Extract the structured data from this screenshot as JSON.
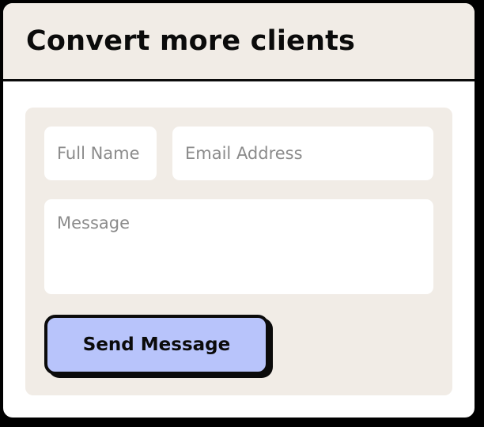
{
  "header": {
    "title": "Convert more clients"
  },
  "form": {
    "full_name": {
      "value": "",
      "placeholder": "Full Name"
    },
    "email": {
      "value": "",
      "placeholder": "Email Address"
    },
    "message": {
      "value": "",
      "placeholder": "Message"
    },
    "submit_label": "Send Message"
  },
  "colors": {
    "page_background": "#000000",
    "card_background": "#ffffff",
    "panel_background": "#f1ece6",
    "button_background": "#b8c4fb",
    "ink": "#0b0b0b",
    "placeholder_text": "#8b8b8b"
  }
}
